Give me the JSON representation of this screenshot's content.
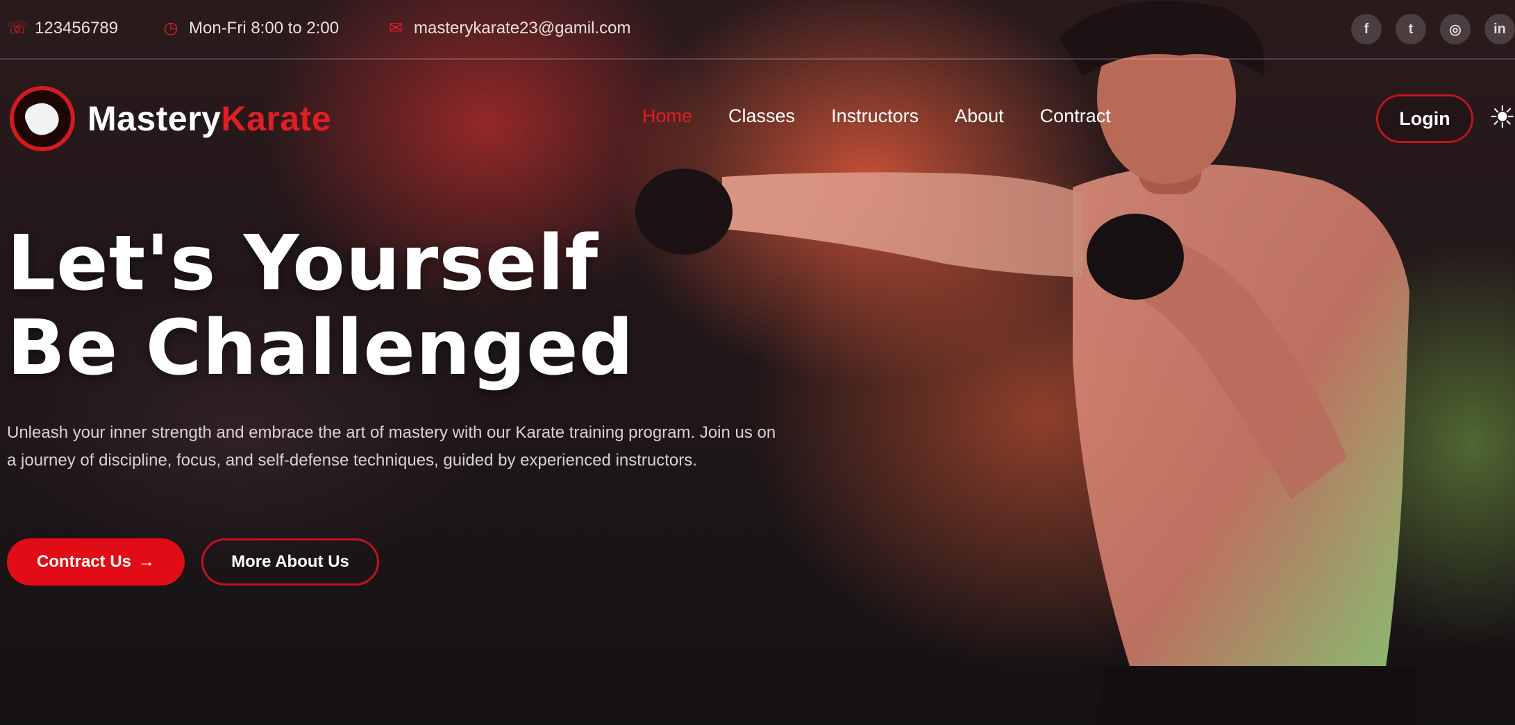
{
  "topbar": {
    "phone": "123456789",
    "hours": "Mon-Fri 8:00 to 2:00",
    "email": "masterykarate23@gamil.com",
    "socials": [
      {
        "icon": "facebook-icon",
        "glyph": "f"
      },
      {
        "icon": "twitter-icon",
        "glyph": "t"
      },
      {
        "icon": "instagram-icon",
        "glyph": "◎"
      },
      {
        "icon": "linkedin-icon",
        "glyph": "in"
      }
    ]
  },
  "brand": {
    "part1": "Mastery",
    "part2": "Karate"
  },
  "nav": {
    "items": [
      "Home",
      "Classes",
      "Instructors",
      "About",
      "Contract"
    ],
    "active": "Home",
    "login_label": "Login"
  },
  "hero": {
    "headline_line1": "Let's Yourself",
    "headline_line2": "Be Challenged",
    "description": "Unleash your inner strength and embrace the art of mastery with our Karate training program. Join us on a journey of discipline, focus, and self-defense techniques, guided by experienced instructors.",
    "primary_button": "Contract Us",
    "primary_arrow": "→",
    "secondary_button": "More About Us"
  },
  "colors": {
    "accent": "#e01e25",
    "background": "#1e1618"
  }
}
